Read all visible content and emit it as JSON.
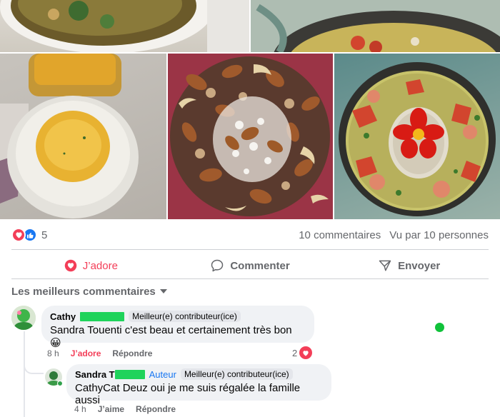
{
  "post": {
    "reactions": {
      "count": "5",
      "icons": [
        "heart-reaction-icon",
        "like-reaction-icon"
      ]
    },
    "comments_count": "10 commentaires",
    "views": "Vu par 10 personnes"
  },
  "actions": {
    "love": "J’adore",
    "comment": "Commenter",
    "share": "Envoyer"
  },
  "comments_header": "Les meilleurs commentaires",
  "comments": [
    {
      "author": "Cathy",
      "badge": "Meilleur(e) contributeur(ice)",
      "mention": "Sandra Touenti",
      "text": " c'est beau et certainement très bon 😀",
      "time": "8 h",
      "love_label": "J’adore",
      "reply_label": "Répondre",
      "reaction_count": "2"
    }
  ],
  "reply": {
    "author": "Sandra T",
    "author_tag": "Auteur",
    "badge": "Meilleur(e) contributeur(ice)",
    "mention": "CathyCat Deuz",
    "text": " oui je me suis régalée la famille aussi",
    "time": "4 h",
    "like_label": "J’aime",
    "reply_label": "Répondre"
  },
  "colors": {
    "love": "#f33e58",
    "like": "#1877f2",
    "redaction": "#1fd35b",
    "secondary_text": "#65676b"
  }
}
